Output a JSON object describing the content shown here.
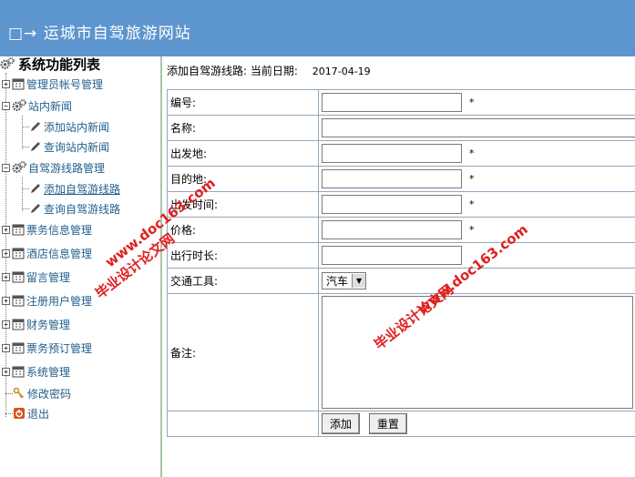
{
  "header": {
    "title": "□→ 运城市自驾旅游网站"
  },
  "sidebar": {
    "title": "系统功能列表",
    "items": [
      {
        "label": "管理员帐号管理"
      },
      {
        "label": "站内新闻"
      },
      {
        "label": "添加站内新闻"
      },
      {
        "label": "查询站内新闻"
      },
      {
        "label": "自驾游线路管理"
      },
      {
        "label": "添加自驾游线路"
      },
      {
        "label": "查询自驾游线路"
      },
      {
        "label": "票务信息管理"
      },
      {
        "label": "酒店信息管理"
      },
      {
        "label": "留言管理"
      },
      {
        "label": "注册用户管理"
      },
      {
        "label": "财务管理"
      },
      {
        "label": "票务预订管理"
      },
      {
        "label": "系统管理"
      },
      {
        "label": "修改密码"
      },
      {
        "label": "退出"
      }
    ]
  },
  "main": {
    "crumb": "添加自驾游线路:  当前日期:",
    "date": "2017-04-19",
    "fields": [
      {
        "label": "编号:",
        "req": "*"
      },
      {
        "label": "名称:"
      },
      {
        "label": "出发地:",
        "req": "*"
      },
      {
        "label": "目的地:",
        "req": "*"
      },
      {
        "label": "出发时间:",
        "req": "*"
      },
      {
        "label": "价格:",
        "req": "*"
      },
      {
        "label": "出行时长:"
      },
      {
        "label": "交通工具:"
      },
      {
        "label": "备注:"
      }
    ],
    "transport_value": "汽车",
    "buttons": {
      "add": "添加",
      "reset": "重置"
    }
  },
  "watermarks": {
    "site": "www.doc163.com",
    "name": "毕业设计论文网"
  }
}
